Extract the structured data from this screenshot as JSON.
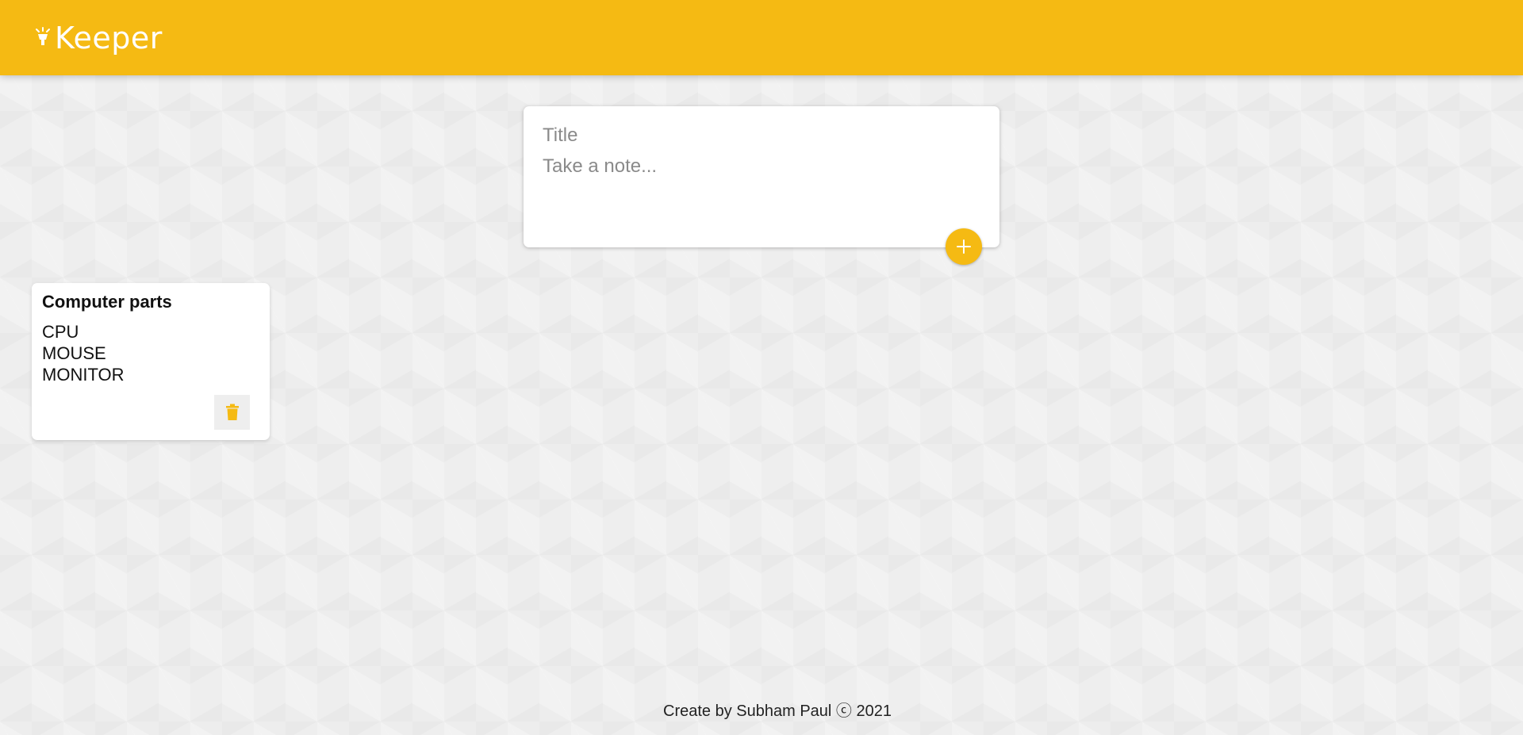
{
  "app": {
    "name": "Keeper"
  },
  "icons": {
    "logo": "lamp-icon",
    "add": "plus-icon",
    "delete": "trash-icon"
  },
  "colors": {
    "accent": "#f5ba13",
    "background": "#eeeeee",
    "card": "#ffffff"
  },
  "create_note": {
    "title_placeholder": "Title",
    "content_placeholder": "Take a note...",
    "title_value": "",
    "content_value": ""
  },
  "notes": [
    {
      "title": "Computer parts",
      "lines": [
        "CPU",
        "MOUSE",
        "MONITOR"
      ]
    }
  ],
  "footer": {
    "text": "Create by Subham Paul ⓒ 2021"
  }
}
